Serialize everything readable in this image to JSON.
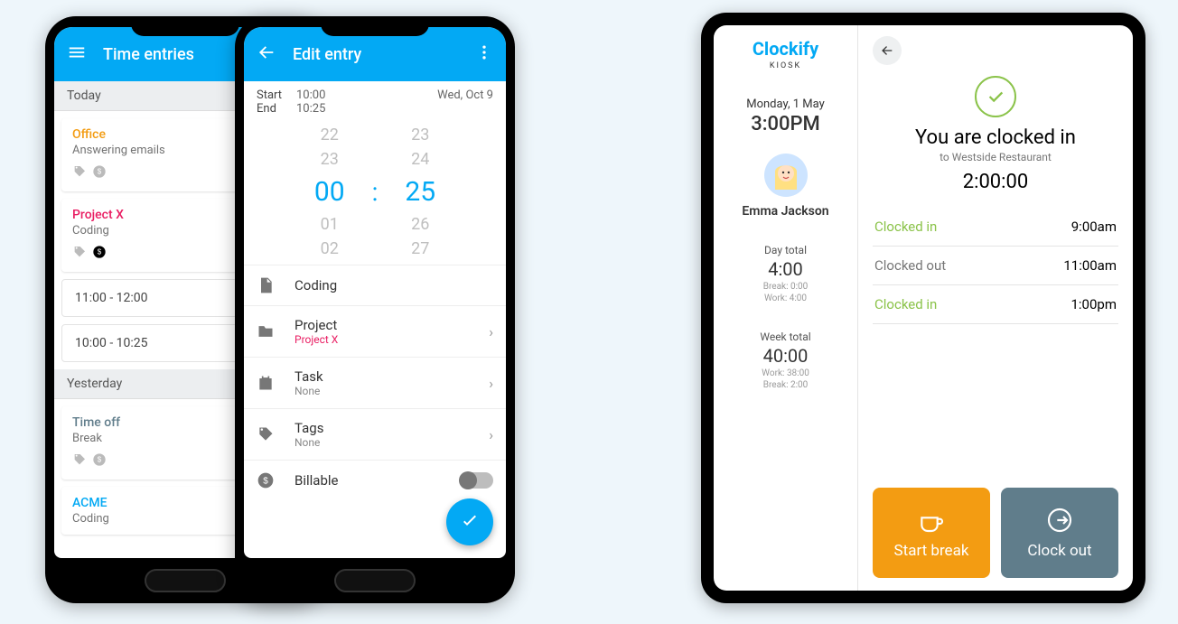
{
  "entries": {
    "appbar_title": "Time entries",
    "today_header": "Today",
    "yesterday_header": "Yesterday",
    "today": [
      {
        "project": "Office",
        "desc": "Answering emails",
        "color": "#f39c12",
        "billable": false
      },
      {
        "project": "Project X",
        "desc": "Coding",
        "color": "#e91e63",
        "billable": true
      }
    ],
    "time_rows": [
      "11:00 - 12:00",
      "10:00 - 10:25"
    ],
    "yesterday": [
      {
        "project": "Time off",
        "desc": "Break",
        "color": "#607d8b"
      },
      {
        "project": "ACME",
        "desc": "Coding",
        "color": "#03a9f4"
      }
    ]
  },
  "edit": {
    "appbar_title": "Edit entry",
    "start_lbl": "Start",
    "start_val": "10:00",
    "end_lbl": "End",
    "end_val": "10:25",
    "date": "Wed, Oct 9",
    "picker_hour": [
      "22",
      "23",
      "00",
      "01",
      "02"
    ],
    "picker_min": [
      "23",
      "24",
      "25",
      "26",
      "27"
    ],
    "desc": "Coding",
    "project_lbl": "Project",
    "project_val": "Project X",
    "task_lbl": "Task",
    "task_val": "None",
    "tags_lbl": "Tags",
    "tags_val": "None",
    "billable_lbl": "Billable"
  },
  "kiosk": {
    "brand": "Clockify",
    "brand_sub": "KIOSK",
    "date": "Monday, 1 May",
    "time": "3:00PM",
    "user": "Emma Jackson",
    "day_lbl": "Day total",
    "day_val": "4:00",
    "day_break": "Break: 0:00",
    "day_work": "Work: 4:00",
    "week_lbl": "Week total",
    "week_val": "40:00",
    "week_work": "Work: 38:00",
    "week_break": "Break: 2:00",
    "heading": "You are clocked in",
    "subheading": "to Westside Restaurant",
    "elapsed": "2:00:00",
    "history": [
      {
        "label": "Clocked in",
        "time": "9:00am",
        "kind": "in"
      },
      {
        "label": "Clocked out",
        "time": "11:00am",
        "kind": "out"
      },
      {
        "label": "Clocked in",
        "time": "1:00pm",
        "kind": "in"
      }
    ],
    "btn_break": "Start break",
    "btn_out": "Clock out"
  }
}
